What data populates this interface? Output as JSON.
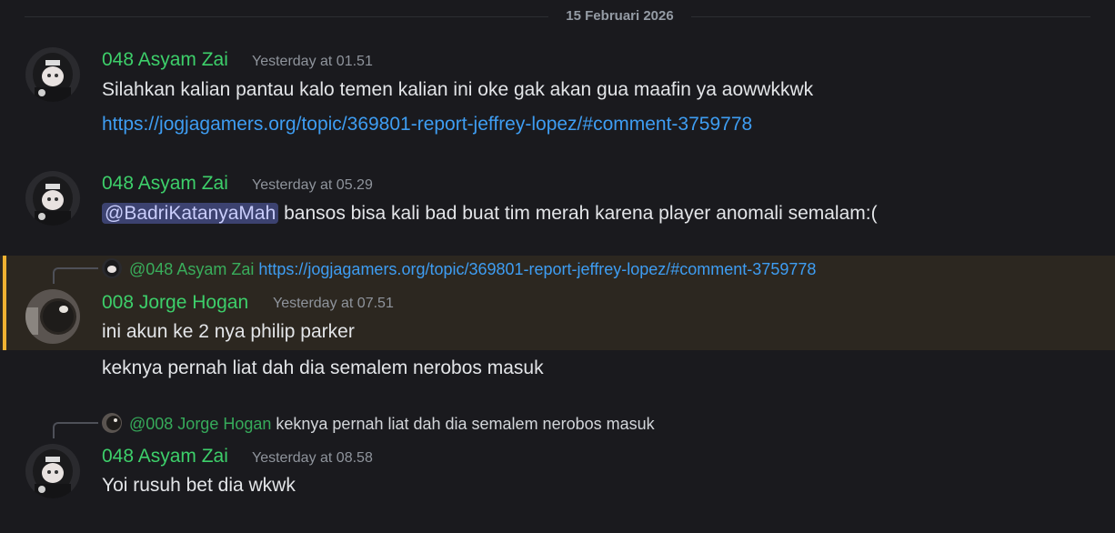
{
  "date_divider": "15 Februari 2026",
  "messages": [
    {
      "user": "048 Asyam Zai",
      "time": "Yesterday at 01.51",
      "text": "Silahkan kalian pantau kalo temen kalian ini oke gak akan gua maafin ya aowwkkwk",
      "link": "https://jogjagamers.org/topic/369801-report-jeffrey-lopez/#comment-3759778"
    },
    {
      "user": "048 Asyam Zai",
      "time": "Yesterday at 05.29",
      "mention": "@BadriKatanyaMah",
      "text": " bansos bisa kali bad buat tim merah karena player anomali semalam:("
    },
    {
      "reply_to_user": "@048 Asyam Zai",
      "reply_to_text": "https://jogjagamers.org/topic/369801-report-jeffrey-lopez/#comment-3759778",
      "user": "008 Jorge Hogan",
      "time": "Yesterday at 07.51",
      "text": "ini akun ke 2 nya philip parker",
      "text2": "keknya pernah liat dah dia semalem nerobos masuk"
    },
    {
      "reply_to_user": "@008 Jorge Hogan",
      "reply_to_text": "keknya pernah liat dah dia semalem nerobos masuk",
      "user": "048 Asyam Zai",
      "time": "Yesterday at 08.58",
      "text": "Yoi rusuh bet dia wkwk"
    }
  ],
  "colors": {
    "background": "#1a1a1e",
    "username": "#3dcf6a",
    "link": "#3e9df2",
    "highlight_bar": "#f0b232"
  }
}
